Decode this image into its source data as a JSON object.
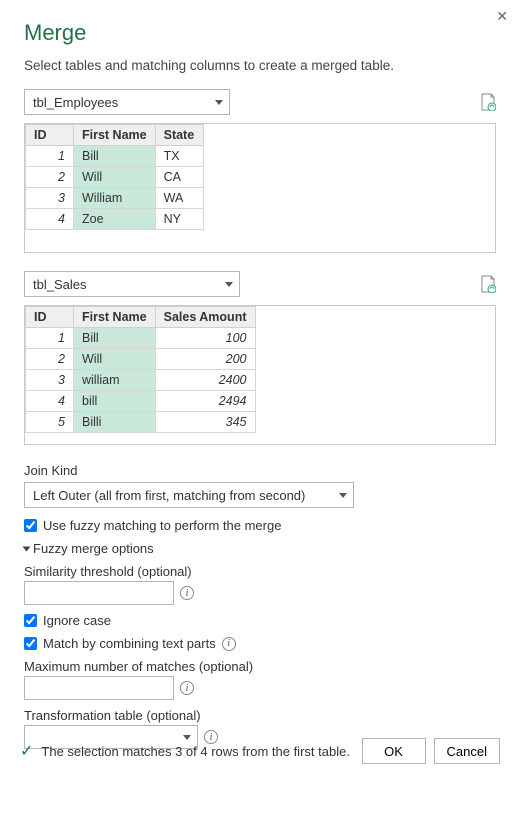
{
  "title": "Merge",
  "subtitle": "Select tables and matching columns to create a merged table.",
  "close_label": "✕",
  "table1": {
    "name": "tbl_Employees",
    "headers": [
      "ID",
      "First Name",
      "State"
    ],
    "rows": [
      {
        "id": "1",
        "first_name": "Bill",
        "col3": "TX"
      },
      {
        "id": "2",
        "first_name": "Will",
        "col3": "CA"
      },
      {
        "id": "3",
        "first_name": "William",
        "col3": "WA"
      },
      {
        "id": "4",
        "first_name": "Zoe",
        "col3": "NY"
      }
    ]
  },
  "table2": {
    "name": "tbl_Sales",
    "headers": [
      "ID",
      "First Name",
      "Sales Amount"
    ],
    "rows": [
      {
        "id": "1",
        "first_name": "Bill",
        "col3": "100"
      },
      {
        "id": "2",
        "first_name": "Will",
        "col3": "200"
      },
      {
        "id": "3",
        "first_name": "william",
        "col3": "2400"
      },
      {
        "id": "4",
        "first_name": "bill",
        "col3": "2494"
      },
      {
        "id": "5",
        "first_name": "Billi",
        "col3": "345"
      }
    ]
  },
  "join_kind_label": "Join Kind",
  "join_kind_value": "Left Outer (all from first, matching from second)",
  "fuzzy_checkbox": "Use fuzzy matching to perform the merge",
  "fuzzy_header": "Fuzzy merge options",
  "similarity_label": "Similarity threshold (optional)",
  "ignore_case_label": "Ignore case",
  "match_combining_label": "Match by combining text parts",
  "max_matches_label": "Maximum number of matches (optional)",
  "transform_table_label": "Transformation table (optional)",
  "status_text": "The selection matches 3 of 4 rows from the first table.",
  "ok_label": "OK",
  "cancel_label": "Cancel",
  "info_glyph": "i"
}
